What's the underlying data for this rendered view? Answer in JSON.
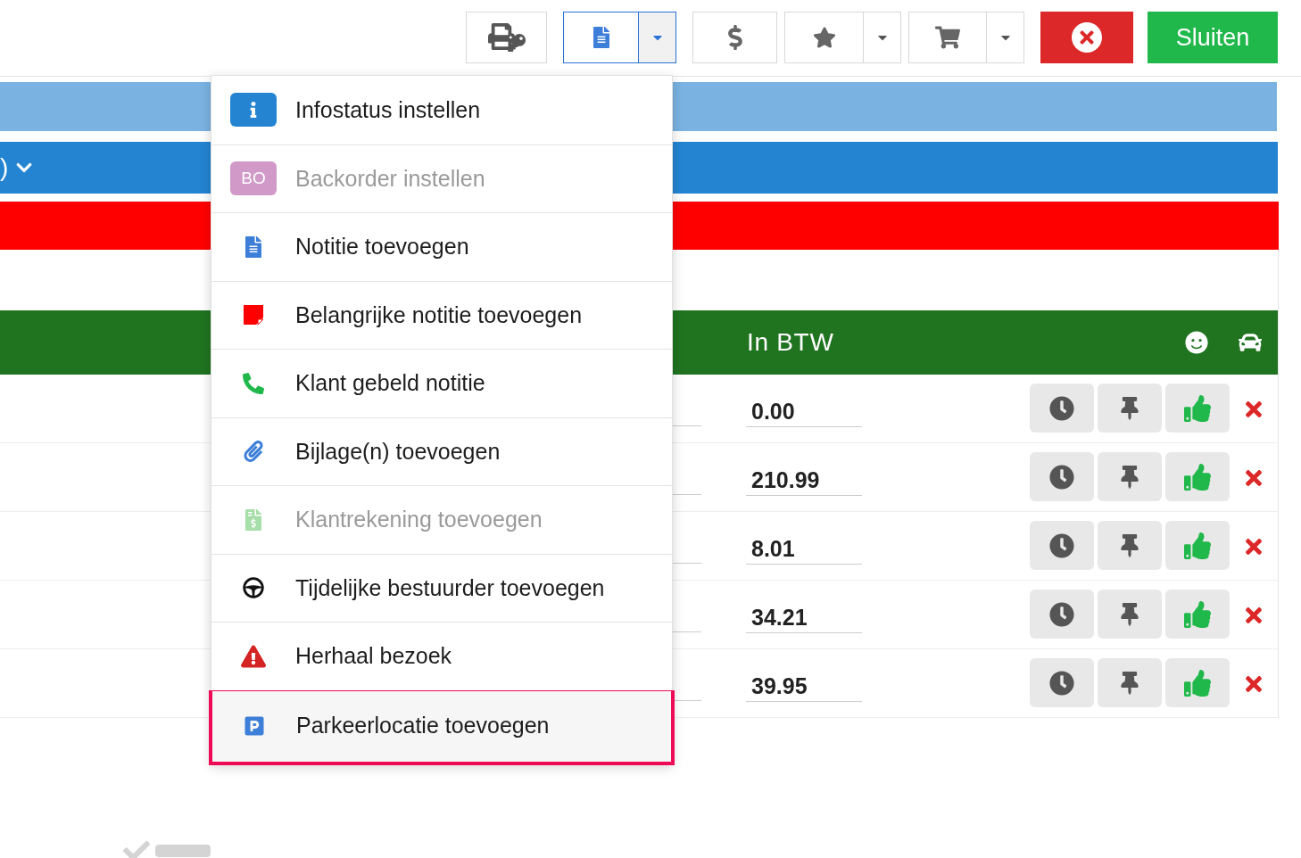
{
  "toolbar": {
    "buttons": [
      {
        "kind": "print-key",
        "selected": false,
        "dropdown": false
      },
      {
        "kind": "note",
        "selected": true,
        "dropdown": true
      },
      {
        "kind": "dollar",
        "selected": false,
        "dropdown": false
      },
      {
        "kind": "star",
        "selected": false,
        "dropdown": true
      },
      {
        "kind": "cart",
        "selected": false,
        "dropdown": true
      }
    ],
    "cancel": {
      "kind": "cancel"
    },
    "close": {
      "label": "Sluiten"
    }
  },
  "blue_band": {
    "text": ")"
  },
  "table": {
    "header": {
      "column_amount": "In BTW"
    },
    "rows": [
      {
        "amount": "0.00"
      },
      {
        "amount": "210.99"
      },
      {
        "amount": "8.01"
      },
      {
        "amount": "34.21"
      },
      {
        "amount": "39.95"
      }
    ]
  },
  "menu": {
    "items": [
      {
        "kind": "info",
        "label": "Infostatus instellen",
        "disabled": false,
        "highlighted": false
      },
      {
        "kind": "backorder",
        "badge": "BO",
        "label": "Backorder instellen",
        "disabled": true,
        "highlighted": false
      },
      {
        "kind": "note",
        "label": "Notitie toevoegen",
        "disabled": false,
        "highlighted": false
      },
      {
        "kind": "important",
        "label": "Belangrijke notitie toevoegen",
        "disabled": false,
        "highlighted": false
      },
      {
        "kind": "phone",
        "label": "Klant gebeld notitie",
        "disabled": false,
        "highlighted": false
      },
      {
        "kind": "attachment",
        "label": "Bijlage(n) toevoegen",
        "disabled": false,
        "highlighted": false
      },
      {
        "kind": "invoice",
        "label": "Klantrekening toevoegen",
        "disabled": true,
        "highlighted": false
      },
      {
        "kind": "driver",
        "label": "Tijdelijke bestuurder toevoegen",
        "disabled": false,
        "highlighted": false
      },
      {
        "kind": "warning",
        "label": "Herhaal bezoek",
        "disabled": false,
        "highlighted": false
      },
      {
        "kind": "parking",
        "label": "Parkeerlocatie toevoegen",
        "disabled": false,
        "highlighted": true
      }
    ]
  }
}
